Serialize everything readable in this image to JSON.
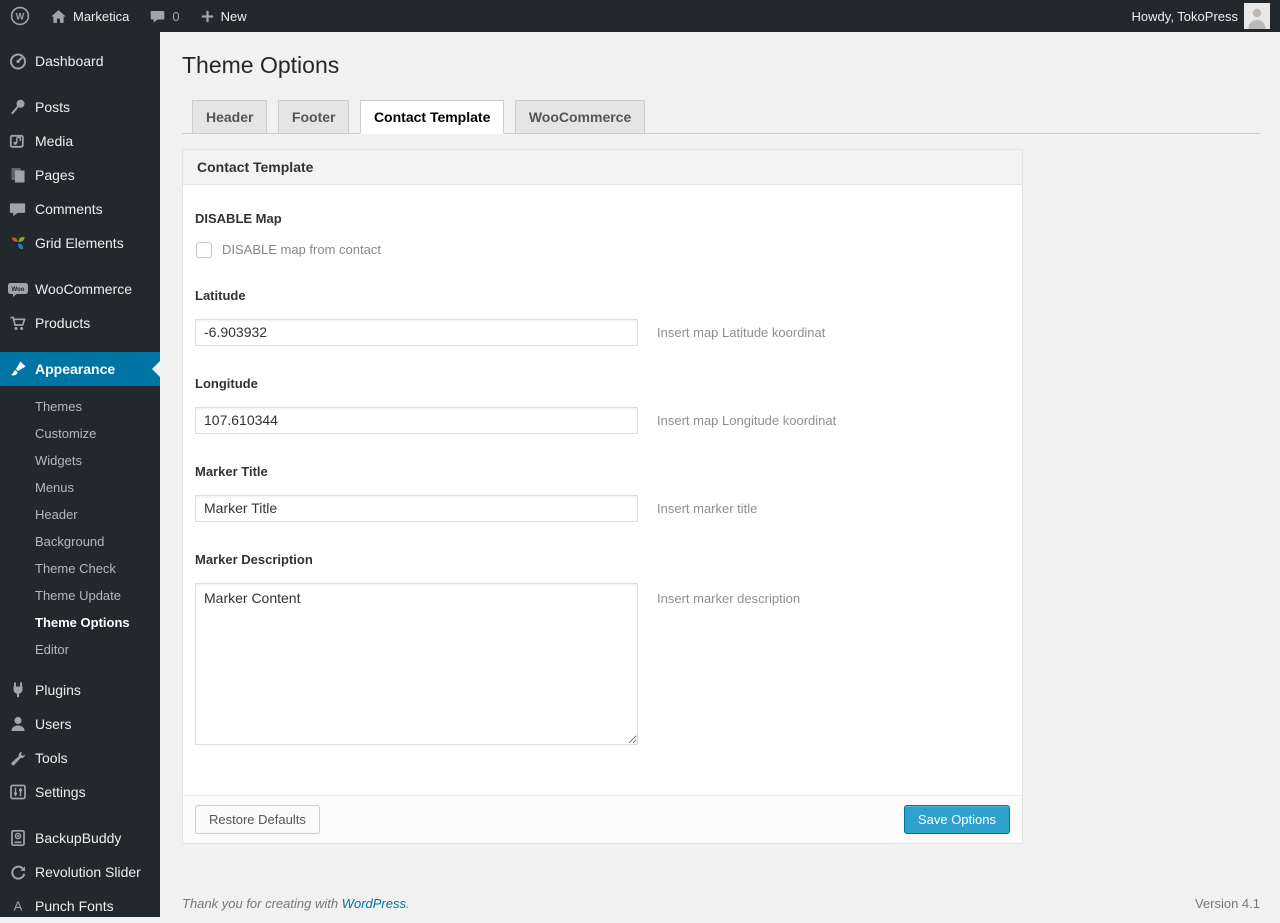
{
  "admin_bar": {
    "site_name": "Marketica",
    "comment_count": "0",
    "new_label": "New",
    "howdy": "Howdy, TokoPress"
  },
  "sidebar": {
    "groups": [
      {
        "items": [
          {
            "label": "Dashboard"
          }
        ]
      },
      {
        "items": [
          {
            "label": "Posts"
          },
          {
            "label": "Media"
          },
          {
            "label": "Pages"
          },
          {
            "label": "Comments"
          },
          {
            "label": "Grid Elements"
          }
        ]
      },
      {
        "items": [
          {
            "label": "WooCommerce"
          },
          {
            "label": "Products"
          }
        ]
      },
      {
        "items": [
          {
            "label": "Appearance",
            "active": true,
            "submenu": [
              "Themes",
              "Customize",
              "Widgets",
              "Menus",
              "Header",
              "Background",
              "Theme Check",
              "Theme Update",
              "Theme Options",
              "Editor"
            ],
            "current_submenu": "Theme Options"
          }
        ]
      },
      {
        "items": [
          {
            "label": "Plugins"
          },
          {
            "label": "Users"
          },
          {
            "label": "Tools"
          },
          {
            "label": "Settings"
          }
        ]
      },
      {
        "items": [
          {
            "label": "BackupBuddy"
          },
          {
            "label": "Revolution Slider"
          },
          {
            "label": "Punch Fonts"
          }
        ]
      }
    ]
  },
  "page": {
    "title": "Theme Options",
    "tabs": [
      {
        "label": "Header",
        "active": false
      },
      {
        "label": "Footer",
        "active": false
      },
      {
        "label": "Contact Template",
        "active": true
      },
      {
        "label": "WooCommerce",
        "active": false
      }
    ],
    "panel": {
      "header": "Contact Template",
      "fields": [
        {
          "type": "checkbox",
          "label": "DISABLE Map",
          "checkbox_label": "DISABLE map from contact",
          "checked": false
        },
        {
          "type": "text",
          "label": "Latitude",
          "value": "-6.903932",
          "hint": "Insert map Latitude koordinat"
        },
        {
          "type": "text",
          "label": "Longitude",
          "value": "107.610344",
          "hint": "Insert map Longitude koordinat"
        },
        {
          "type": "text",
          "label": "Marker Title",
          "value": "Marker Title",
          "hint": "Insert marker title"
        },
        {
          "type": "textarea",
          "label": "Marker Description",
          "value": "Marker Content",
          "hint": "Insert marker description"
        }
      ],
      "restore_button": "Restore Defaults",
      "save_button": "Save Options"
    }
  },
  "footer": {
    "thanks_prefix": "Thank you for creating with",
    "wordpress_link": "WordPress",
    "thanks_suffix": ".",
    "version": "Version 4.1"
  },
  "icons": {
    "wordpress_logo": "W in circle",
    "home": "house",
    "comments": "speech bubble",
    "new": "plus",
    "dashboard": "gauge",
    "posts": "pin",
    "media": "frame with note",
    "pages": "stacked pages",
    "grid_elements": "three colored leaves",
    "woocommerce": "woo badge bubble",
    "products": "shopping cart",
    "appearance": "paint brush",
    "plugins": "plug",
    "users": "person",
    "tools": "wrench",
    "settings": "slider panel",
    "backupbuddy": "backup drive",
    "revolution_slider": "refresh arrows",
    "punch_fonts": "letter A",
    "avatar": "person silhouette"
  },
  "colors": {
    "admin_bar_bg": "#23282d",
    "sidebar_bg": "#23282d",
    "menu_highlight": "#0074a2",
    "content_bg": "#f1f1f1",
    "primary_button": "#2ea2cc",
    "primary_button_border": "#0074a2",
    "link": "#0074a2"
  }
}
